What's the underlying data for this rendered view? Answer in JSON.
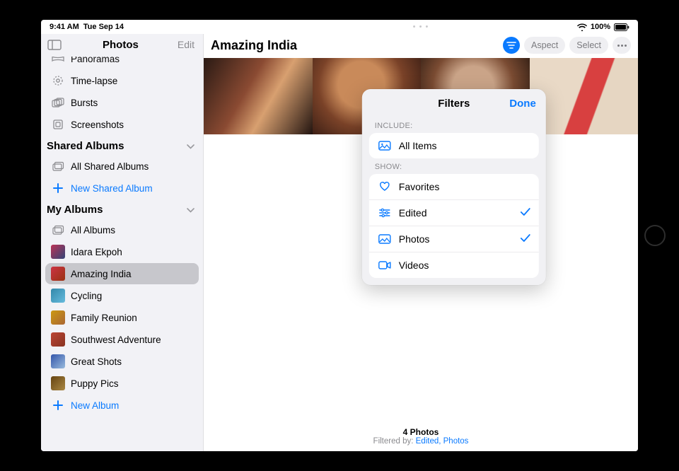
{
  "status": {
    "time": "9:41 AM",
    "date": "Tue Sep 14",
    "battery": "100%"
  },
  "sidebar": {
    "title": "Photos",
    "edit": "Edit",
    "media_types": {
      "panoramas": "Panoramas",
      "timelapse": "Time-lapse",
      "bursts": "Bursts",
      "screenshots": "Screenshots"
    },
    "shared": {
      "header": "Shared Albums",
      "all": "All Shared Albums",
      "new": "New Shared Album"
    },
    "my": {
      "header": "My Albums",
      "all": "All Albums",
      "items": [
        "Idara Ekpoh",
        "Amazing India",
        "Cycling",
        "Family Reunion",
        "Southwest Adventure",
        "Great Shots",
        "Puppy Pics"
      ],
      "new": "New Album"
    }
  },
  "content": {
    "title": "Amazing India",
    "aspect": "Aspect",
    "select": "Select",
    "count": "4 Photos",
    "filtered_prefix": "Filtered by: ",
    "filtered_links": "Edited, Photos"
  },
  "filters": {
    "title": "Filters",
    "done": "Done",
    "include_label": "INCLUDE:",
    "all_items": "All Items",
    "show_label": "SHOW:",
    "favorites": "Favorites",
    "edited": "Edited",
    "photos": "Photos",
    "videos": "Videos"
  }
}
